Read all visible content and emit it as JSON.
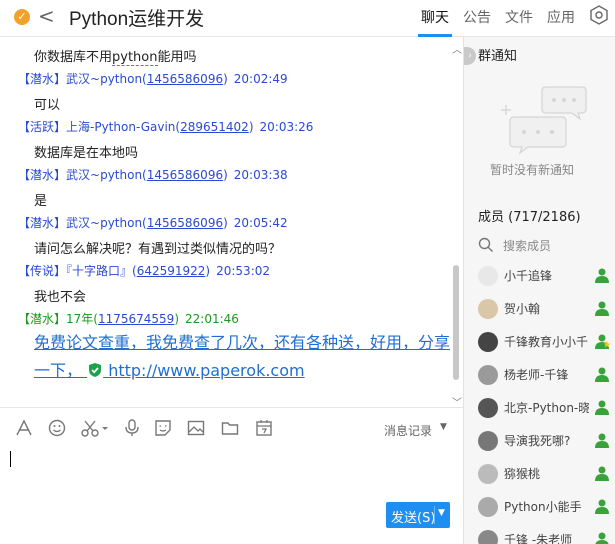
{
  "header": {
    "title": "Python运维开发",
    "tabs": [
      {
        "label": "聊天",
        "active": true
      },
      {
        "label": "公告",
        "active": false
      },
      {
        "label": "文件",
        "active": false
      },
      {
        "label": "应用",
        "active": false
      }
    ],
    "badge_icon": "check-badge-icon",
    "back_icon": "chevron-left-icon",
    "settings_icon": "hexagon-settings-icon"
  },
  "chat": {
    "messages": [
      {
        "type": "text",
        "text_before": "你数据库不用",
        "link": "python",
        "text_after": "能用吗"
      },
      {
        "type": "meta",
        "tag": "【潜水】",
        "name": "武汉~python(",
        "uid": "1456586096",
        "close": ")",
        "time": "20:02:49"
      },
      {
        "type": "text",
        "text": "可以"
      },
      {
        "type": "meta",
        "tag": "【活跃】",
        "name": "上海-Python-Gavin(",
        "uid": "289651402",
        "close": ")",
        "time": "20:03:26"
      },
      {
        "type": "text",
        "text": "数据库是在本地吗"
      },
      {
        "type": "meta",
        "tag": "【潜水】",
        "name": "武汉~python(",
        "uid": "1456586096",
        "close": ")",
        "time": "20:03:38"
      },
      {
        "type": "text",
        "text": "是"
      },
      {
        "type": "meta",
        "tag": "【潜水】",
        "name": "武汉~python(",
        "uid": "1456586096",
        "close": ")",
        "time": "20:05:42"
      },
      {
        "type": "text",
        "text": "请问怎么解决呢？有遇到过类似情况的吗？"
      },
      {
        "type": "meta",
        "tag": "【传说】",
        "name": "『十字路口』(",
        "uid": "642591922",
        "close": ")",
        "time": "20:53:02"
      },
      {
        "type": "text",
        "text": "我也不会"
      },
      {
        "type": "meta",
        "tag": "【潜水】",
        "name": "17年(",
        "uid": "1175674559",
        "close": ")",
        "time": "22:01:46"
      },
      {
        "type": "ad",
        "line1": "免费论文查重，我免费查了几次，还有各种送，好用，分享",
        "line2_prefix": "一下，",
        "url": "http://www.paperok.com"
      }
    ]
  },
  "toolbar": {
    "icons": [
      "font-icon",
      "emoji-icon",
      "scissors-icon",
      "microphone-icon",
      "sticker-icon",
      "image-icon",
      "folder-icon",
      "calendar-icon"
    ],
    "history_label": "消息记录"
  },
  "input": {
    "send_label": "发送(S)"
  },
  "right_panel": {
    "notice_title": "群通知",
    "notice_empty": "暂时没有新通知",
    "members_title": "成员 (717/2186)",
    "search_placeholder": "搜索成员",
    "members": [
      {
        "name": "小千追锋",
        "role": "admin"
      },
      {
        "name": "贺小翰",
        "role": "admin"
      },
      {
        "name": "千锋教育小小千",
        "role": "owner"
      },
      {
        "name": "杨老师-千锋",
        "role": "admin"
      },
      {
        "name": "北京-Python-晓",
        "role": "admin"
      },
      {
        "name": "导演我死哪?",
        "role": "admin"
      },
      {
        "name": "猕猴桃",
        "role": "admin"
      },
      {
        "name": "Python小能手",
        "role": "admin"
      },
      {
        "name": "千锋 -朱老师",
        "role": "admin"
      }
    ]
  },
  "colors": {
    "accent": "#1f8ef1",
    "meta_blue": "#2a4bd1",
    "meta_green": "#1a9a1a",
    "admin_green": "#3aa23a",
    "owner_yellow": "#f5c518"
  }
}
